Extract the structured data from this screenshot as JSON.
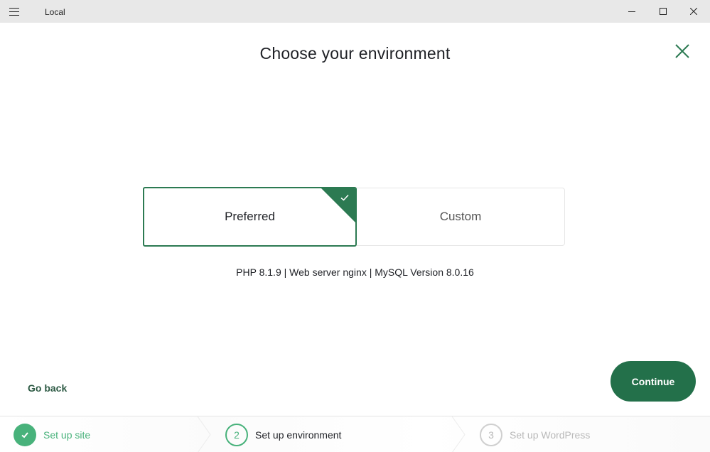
{
  "window": {
    "title": "Local",
    "icons": {
      "menu": "hamburger-icon",
      "minimize": "minimize-icon",
      "maximize": "maximize-icon",
      "close": "close-icon"
    }
  },
  "page": {
    "title": "Choose your environment",
    "close_icon": "close-icon"
  },
  "environment": {
    "options": [
      {
        "label": "Preferred",
        "selected": true
      },
      {
        "label": "Custom",
        "selected": false
      }
    ],
    "details": "PHP 8.1.9 | Web server nginx | MySQL Version 8.0.16"
  },
  "actions": {
    "back_label": "Go back",
    "continue_label": "Continue"
  },
  "steps": [
    {
      "number": "1",
      "label": "Set up site",
      "state": "complete"
    },
    {
      "number": "2",
      "label": "Set up environment",
      "state": "active"
    },
    {
      "number": "3",
      "label": "Set up WordPress",
      "state": "upcoming"
    }
  ],
  "colors": {
    "accent": "#2c7a52",
    "button": "#23704a",
    "step_complete": "#48b27b",
    "step_upcoming": "#b9b9b9"
  }
}
